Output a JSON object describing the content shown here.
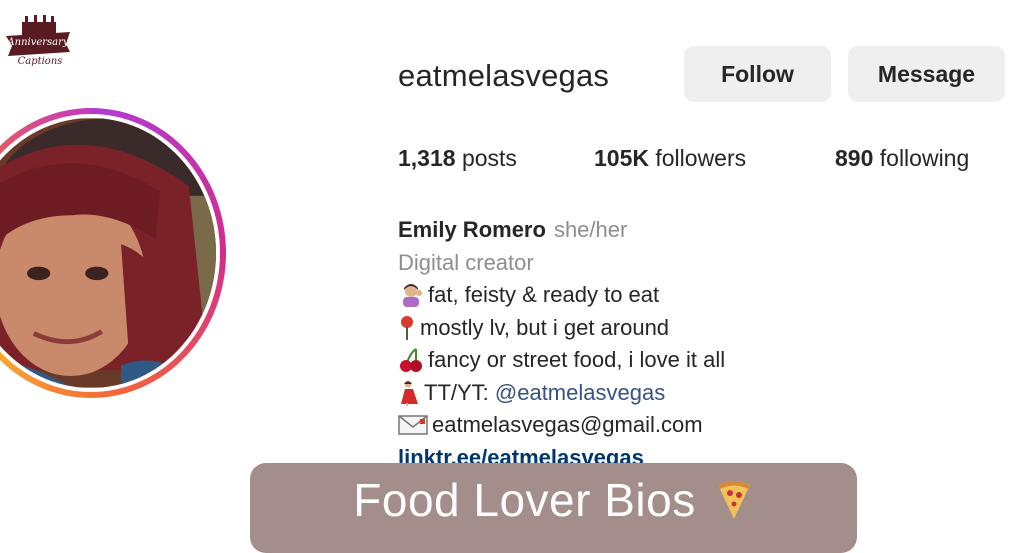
{
  "brand": {
    "logo_top": "Anniversary",
    "logo_bottom": "Captions"
  },
  "profile": {
    "username": "eatmelasvegas",
    "follow_label": "Follow",
    "message_label": "Message",
    "stats": {
      "posts_count": "1,318",
      "posts_label": "posts",
      "followers_count": "105K",
      "followers_label": "followers",
      "following_count": "890",
      "following_label": "following"
    },
    "bio": {
      "name": "Emily Romero",
      "pronouns": "she/her",
      "category": "Digital creator",
      "lines": [
        {
          "icon": "woman-tipping-hand-icon",
          "text": "fat, feisty & ready to eat"
        },
        {
          "icon": "round-pushpin-icon",
          "text": "mostly lv, but i get around"
        },
        {
          "icon": "cherries-icon",
          "text": "fancy or street food, i love it all"
        },
        {
          "icon": "dancer-icon",
          "prefix": "TT/YT: ",
          "text": "@eatmelasvegas"
        },
        {
          "icon": "envelope-icon",
          "text": "eatmelasvegas@gmail.com"
        }
      ],
      "link": "linktr.ee/eatmelasvegas"
    }
  },
  "banner": {
    "title": "Food Lover Bios",
    "icon": "pizza-icon"
  },
  "colors": {
    "button_bg": "#efefef",
    "link_blue": "#00376b",
    "banner_bg": "#a48e8c",
    "ring_gradient": [
      "#b23bd6",
      "#d22c8c",
      "#f2663a",
      "#f9b231"
    ]
  }
}
